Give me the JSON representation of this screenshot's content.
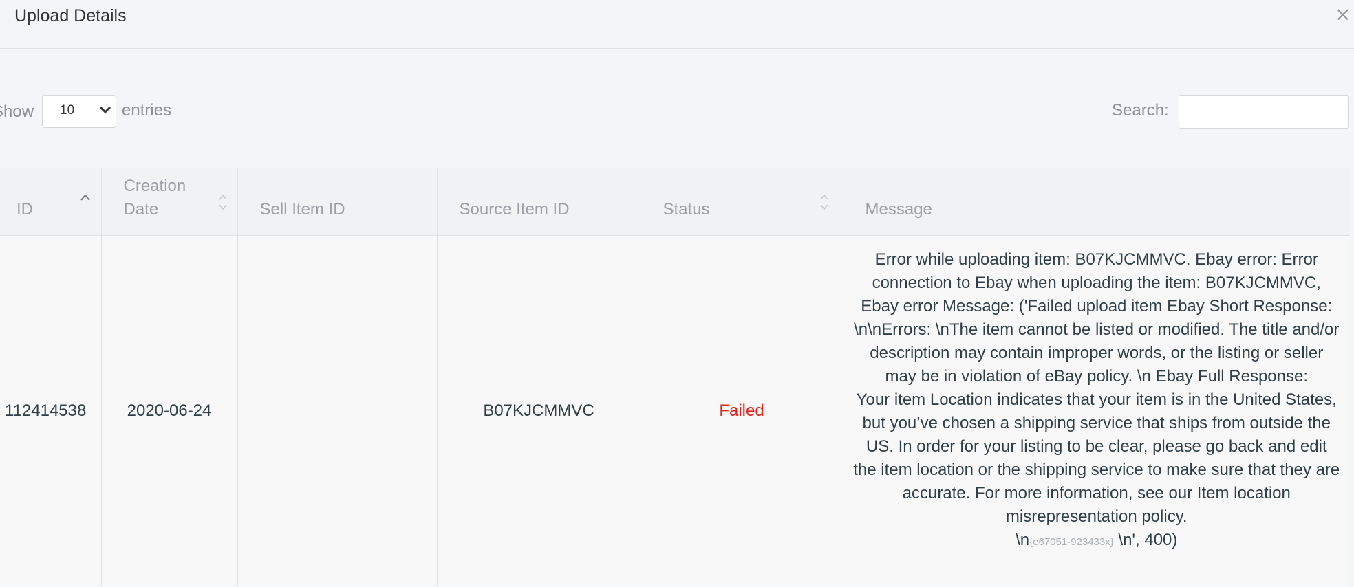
{
  "modal": {
    "title": "Upload Details",
    "close_label": "×"
  },
  "controls": {
    "show_label": "Show",
    "entries_label": "entries",
    "entries_selected": "10",
    "search_label": "Search:",
    "search_value": ""
  },
  "table": {
    "headers": {
      "id": "ID",
      "creation_date": "Creation Date",
      "sell_item_id": "Sell Item ID",
      "source_item_id": "Source Item ID",
      "status": "Status",
      "message": "Message"
    },
    "rows": [
      {
        "id": "112414538",
        "creation_date": "2020-06-24",
        "sell_item_id": "",
        "source_item_id": "B07KJCMMVC",
        "status": "Failed",
        "status_color": "#e2231a",
        "message_main": "Error while uploading item: B07KJCMMVC. Ebay error: Error connection to Ebay when uploading the item: B07KJCMMVC, Ebay error Message: ('Failed upload item Ebay Short Response: \\n\\nErrors: \\nThe item cannot be listed or modified. The title and/or description may contain improper words, or the listing or seller may be in violation of eBay policy. \\n Ebay Full Response:\nYour item Location indicates that your item is in the United States, but you’ve chosen a shipping service that ships from outside the US. In order for your listing to be clear, please go back and edit the item location or the shipping service to make sure that they are accurate.  For more information, see our Item location misrepresentation policy.",
        "message_tail_prefix": "\\n",
        "message_tail_code": "{e67051-923433x}",
        "message_tail_suffix": " \\n', 400)"
      }
    ]
  }
}
